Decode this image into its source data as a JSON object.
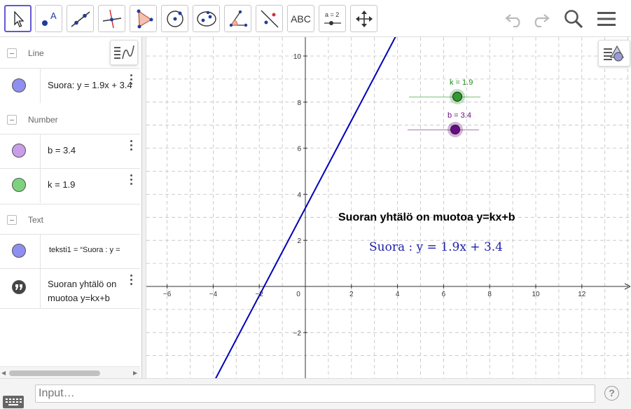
{
  "toolbar": {
    "tools": [
      {
        "icon": "move-arrow-icon"
      },
      {
        "icon": "point-icon",
        "letter": "A"
      },
      {
        "icon": "line-icon"
      },
      {
        "icon": "perpendicular-line-icon"
      },
      {
        "icon": "polygon-icon"
      },
      {
        "icon": "circle-center-point-icon"
      },
      {
        "icon": "conic-ellipse-icon"
      },
      {
        "icon": "angle-icon"
      },
      {
        "icon": "reflect-icon"
      },
      {
        "icon": "text-tool-icon",
        "label": "ABC"
      },
      {
        "icon": "slider-tool-icon",
        "label": "a = 2"
      },
      {
        "icon": "move-view-icon"
      }
    ],
    "right": [
      "undo-icon",
      "redo-icon",
      "search-icon",
      "menu-icon"
    ]
  },
  "algebra": {
    "categories": [
      {
        "label": "Line"
      },
      {
        "label": "Number"
      },
      {
        "label": "Text"
      }
    ],
    "items": [
      {
        "expr": "Suora: y = 1.9x + 3.4",
        "color": "#8f8fef"
      },
      {
        "expr": "b = 3.4",
        "color": "#c89ee8"
      },
      {
        "expr": "k = 1.9",
        "color": "#7dd37d"
      },
      {
        "expr": "teksti1 = “Suora : y =",
        "color": "#8f8fef"
      },
      {
        "expr_line1": "Suoran yhtälö on",
        "expr_line2": "muotoa y=kx+b"
      }
    ]
  },
  "graphics": {
    "axes": {
      "x_ticks": [
        "−6",
        "−4",
        "−2",
        "0",
        "2",
        "4",
        "6",
        "8",
        "10",
        "12"
      ],
      "y_ticks": [
        "10",
        "8",
        "6",
        "4",
        "2",
        "−2"
      ]
    },
    "line": {
      "k": 1.9,
      "b": 3.4,
      "color": "#0000b8"
    },
    "sliders": [
      {
        "label": "k = 1.9",
        "color": "#1a8a1a",
        "fill": "#2e9b2e"
      },
      {
        "label": "b = 3.4",
        "color": "#660a7a",
        "fill": "#6a0a86"
      }
    ],
    "title_text": "Suoran yhtälö on muotoa y=kx+b",
    "equation_text": "Suora :  y = 1.9x + 3.4"
  },
  "input": {
    "placeholder": "Input…"
  },
  "help": "?"
}
